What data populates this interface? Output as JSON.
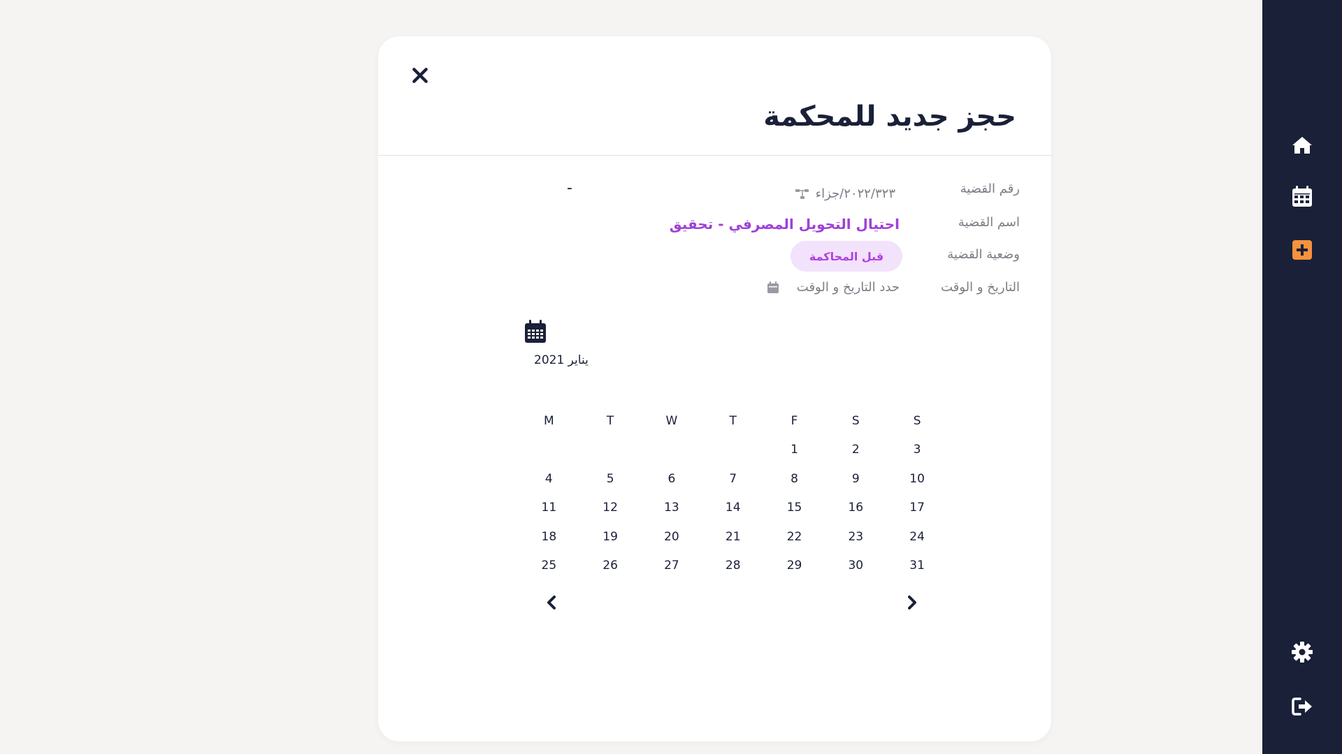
{
  "modal": {
    "title": "حجز جديد للمحكمة"
  },
  "case_number": {
    "label": "رقم القضية",
    "value": "٢٠٢٢/٣٢٣/جزاء",
    "secondary": "-"
  },
  "case_name": {
    "label": "اسم القضية",
    "value": "احتيال التحويل المصرفي - تحقيق"
  },
  "case_status": {
    "label": "وضعية القضية",
    "value": "قبل المحاكمة"
  },
  "date_time": {
    "label": "التاريخ و الوقت",
    "placeholder": "حدد التاريخ و الوقت"
  },
  "calendar": {
    "month_label": "يناير 2021",
    "weekdays": [
      "S",
      "S",
      "F",
      "T",
      "W",
      "T",
      "M"
    ],
    "weeks": [
      [
        "3",
        "2",
        "1",
        "",
        "",
        "",
        ""
      ],
      [
        "10",
        "9",
        "8",
        "7",
        "6",
        "5",
        "4"
      ],
      [
        "17",
        "16",
        "15",
        "14",
        "13",
        "12",
        "11"
      ],
      [
        "24",
        "23",
        "22",
        "21",
        "20",
        "19",
        "18"
      ],
      [
        "31",
        "30",
        "29",
        "28",
        "27",
        "26",
        "25"
      ]
    ]
  },
  "sidebar": {
    "items": [
      {
        "icon": "home-icon"
      },
      {
        "icon": "calendar-icon"
      },
      {
        "icon": "plus-square-icon",
        "active": true
      },
      {
        "icon": "gear-icon"
      },
      {
        "icon": "logout-icon"
      }
    ]
  },
  "colors": {
    "sidebar_bg": "#1a2038",
    "accent_orange": "#f5923e",
    "accent_purple": "#a040d8",
    "pill_bg": "#f3e2fb"
  }
}
